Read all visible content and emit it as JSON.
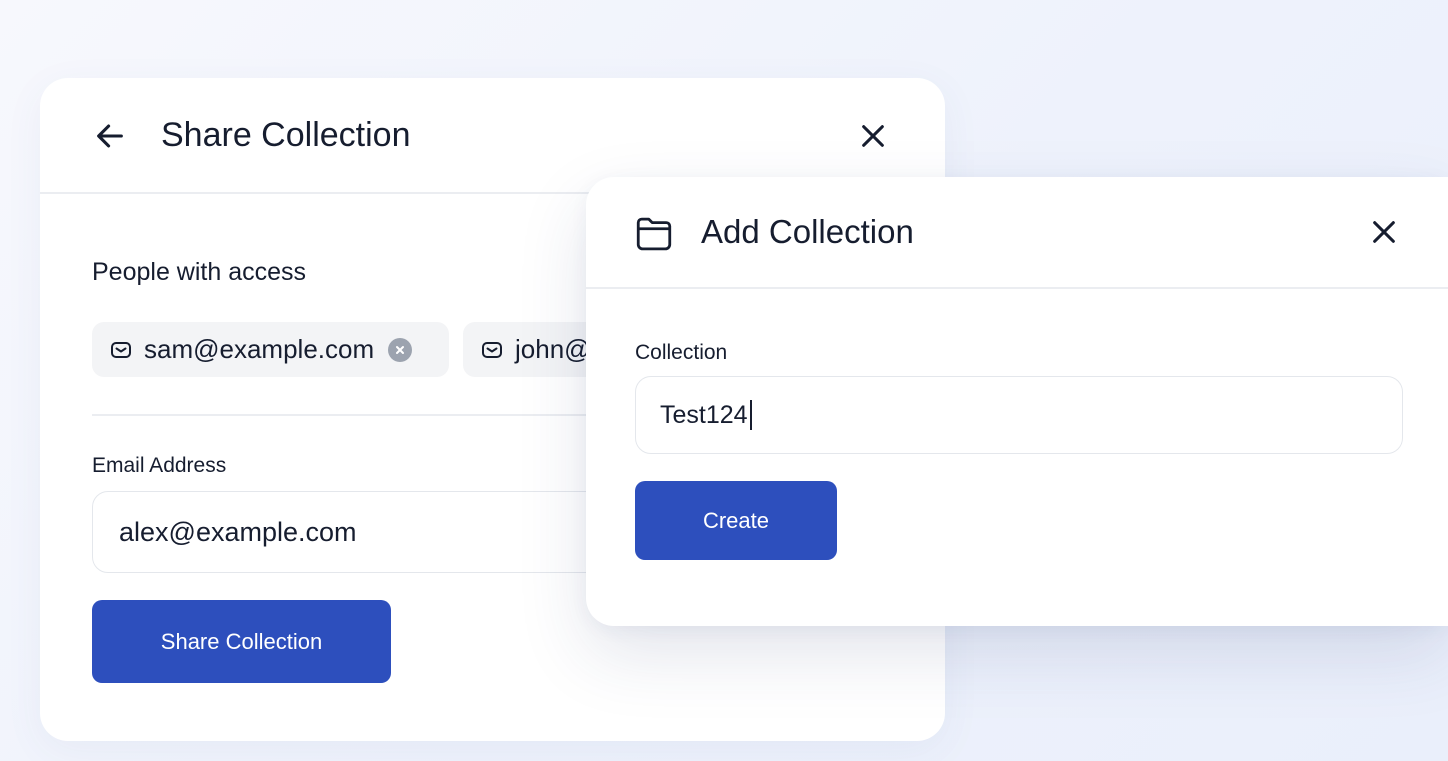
{
  "share_dialog": {
    "title": "Share Collection",
    "back_icon": "arrow-left-icon",
    "close_icon": "close-icon",
    "people_label": "People with access",
    "people": [
      {
        "email": "sam@example.com",
        "icon": "mail-icon",
        "remove_icon": "remove-circle-icon"
      },
      {
        "email": "john@example.com",
        "icon": "mail-icon",
        "remove_icon": "remove-circle-icon"
      }
    ],
    "email_label": "Email Address",
    "email_value": "alex@example.com",
    "submit_label": "Share Collection"
  },
  "add_dialog": {
    "title": "Add Collection",
    "title_icon": "folder-icon",
    "close_icon": "close-icon",
    "field_label": "Collection",
    "field_value": "Test124",
    "submit_label": "Create"
  },
  "colors": {
    "primary": "#2d4fbd",
    "text": "#161d2f",
    "chip_background": "#f3f4f6",
    "border": "#e4e7ec",
    "page_background": "#eef2fc"
  }
}
